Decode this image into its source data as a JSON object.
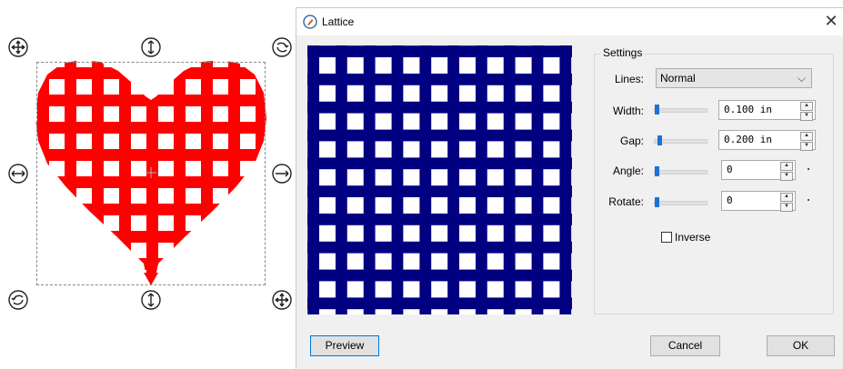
{
  "dialog": {
    "title": "Lattice",
    "close_glyph": "✕",
    "settings_title": "Settings",
    "fields": {
      "lines_label": "Lines:",
      "lines_value": "Normal",
      "width_label": "Width:",
      "width_value": "0.100 in",
      "width_slider_level": 0.02,
      "gap_label": "Gap:",
      "gap_value": "0.200 in",
      "gap_slider_level": 0.05,
      "angle_label": "Angle:",
      "angle_value": "0",
      "angle_slider_level": 0.0,
      "rotate_label": "Rotate:",
      "rotate_value": "0",
      "rotate_slider_level": 0.0
    },
    "inverse_label": "Inverse",
    "inverse_checked": false,
    "buttons": {
      "preview": "Preview",
      "cancel": "Cancel",
      "ok": "OK"
    }
  },
  "colors": {
    "heart": "#ff0000",
    "lattice": "#000080",
    "slider_thumb": "#1a73d9"
  },
  "icons": {
    "handles": [
      "move-icon",
      "stretch-vertical-icon",
      "rotate-icon",
      "stretch-horizontal-icon",
      "scale-icon"
    ],
    "title": "lattice-pen-icon"
  }
}
